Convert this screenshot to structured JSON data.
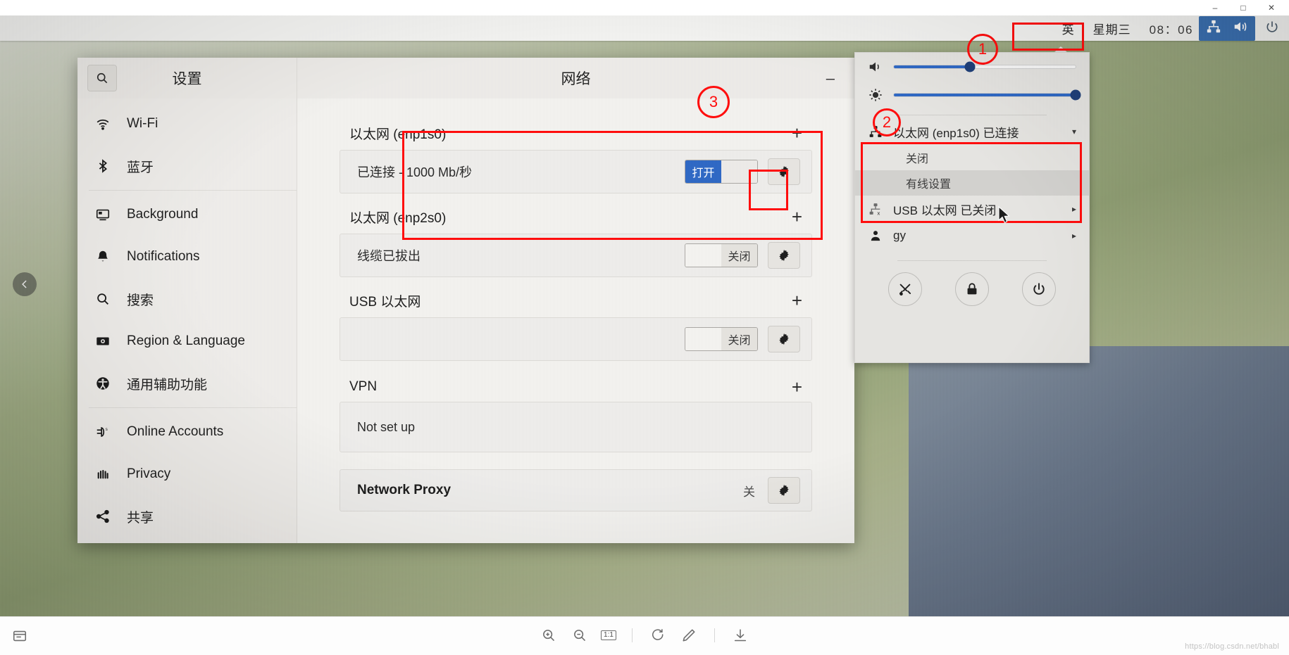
{
  "viewer": {
    "window_buttons": [
      "–",
      "□",
      "✕"
    ],
    "toolbar": {
      "save_icon": "save-icon",
      "zoom_in_icon": "zoom-in-icon",
      "zoom_out_icon": "zoom-out-icon",
      "ratio_label": "1:1",
      "rotate_icon": "rotate-icon",
      "edit_icon": "pencil-icon",
      "download_icon": "download-icon"
    },
    "watermark": "https://blog.csdn.net/bhabl"
  },
  "topbar": {
    "input_method": "英",
    "day": "星期三",
    "clock": "08：06",
    "network_icon": "network-wired-icon",
    "volume_icon": "volume-icon",
    "power_icon": "power-icon",
    "indicator_bg": "#3a6fb0"
  },
  "sysmenu": {
    "volume": {
      "icon": "volume-icon",
      "value": 42
    },
    "brightness": {
      "icon": "brightness-icon",
      "value": 100
    },
    "network_entry": {
      "icon": "network-wired-icon",
      "label": "以太网 (enp1s0) 已连接",
      "chevron": "▾"
    },
    "network_sub": [
      {
        "label": "关闭",
        "highlighted": false
      },
      {
        "label": "有线设置",
        "highlighted": true
      }
    ],
    "usb_entry": {
      "icon": "network-usb-off-icon",
      "label": "USB 以太网 已关闭",
      "chevron": "▸"
    },
    "user_entry": {
      "icon": "user-icon",
      "label": "gy",
      "chevron": "▸"
    },
    "actions": [
      {
        "name": "settings-button",
        "icon": "tools-icon"
      },
      {
        "name": "lock-button",
        "icon": "lock-icon"
      },
      {
        "name": "power-button",
        "icon": "power-icon"
      }
    ]
  },
  "settings": {
    "search_icon": "search-icon",
    "title": "设置",
    "panel_title": "网络",
    "minimize_label": "–",
    "sidebar": [
      {
        "label": "Wi-Fi",
        "icon": "wifi-icon"
      },
      {
        "label": "蓝牙",
        "icon": "bluetooth-icon"
      },
      {
        "separator_after": true
      },
      {
        "label": "Background",
        "icon": "background-icon"
      },
      {
        "label": "Notifications",
        "icon": "bell-icon"
      },
      {
        "label": "搜索",
        "icon": "search-icon"
      },
      {
        "label": "Region & Language",
        "icon": "region-icon"
      },
      {
        "label": "通用辅助功能",
        "icon": "accessibility-icon"
      },
      {
        "separator_after": true
      },
      {
        "label": "Online Accounts",
        "icon": "online-accounts-icon"
      },
      {
        "label": "Privacy",
        "icon": "privacy-icon"
      },
      {
        "label": "共享",
        "icon": "share-icon"
      }
    ],
    "sections": [
      {
        "name": "ethernet-enp1s0",
        "heading": "以太网 (enp1s0)",
        "add_label": "+",
        "status": "已连接 - 1000 Mb/秒",
        "switch_on_label": "打开",
        "switch_off_label": "",
        "switch_state": "on",
        "gear_icon": "gear-icon"
      },
      {
        "name": "ethernet-enp2s0",
        "heading": "以太网 (enp2s0)",
        "add_label": "+",
        "status": "线缆已拔出",
        "switch_on_label": "",
        "switch_off_label": "关闭",
        "switch_state": "off",
        "gear_icon": "gear-icon"
      },
      {
        "name": "usb-ethernet",
        "heading": "USB 以太网",
        "add_label": "+",
        "status": "",
        "switch_on_label": "",
        "switch_off_label": "关闭",
        "switch_state": "off",
        "gear_icon": "gear-icon"
      },
      {
        "name": "vpn",
        "heading": "VPN",
        "add_label": "+",
        "status": "Not set up",
        "switch_state": "none",
        "gear_icon": ""
      }
    ],
    "proxy": {
      "label": "Network Proxy",
      "state_label": "关",
      "gear_icon": "gear-icon"
    }
  },
  "annotations": [
    {
      "id": "1",
      "type": "circle",
      "label": "1"
    },
    {
      "id": "2",
      "type": "circle",
      "label": "2"
    },
    {
      "id": "3",
      "type": "circle",
      "label": "3"
    }
  ],
  "nav": {
    "prev_icon": "chevron-left-icon"
  }
}
